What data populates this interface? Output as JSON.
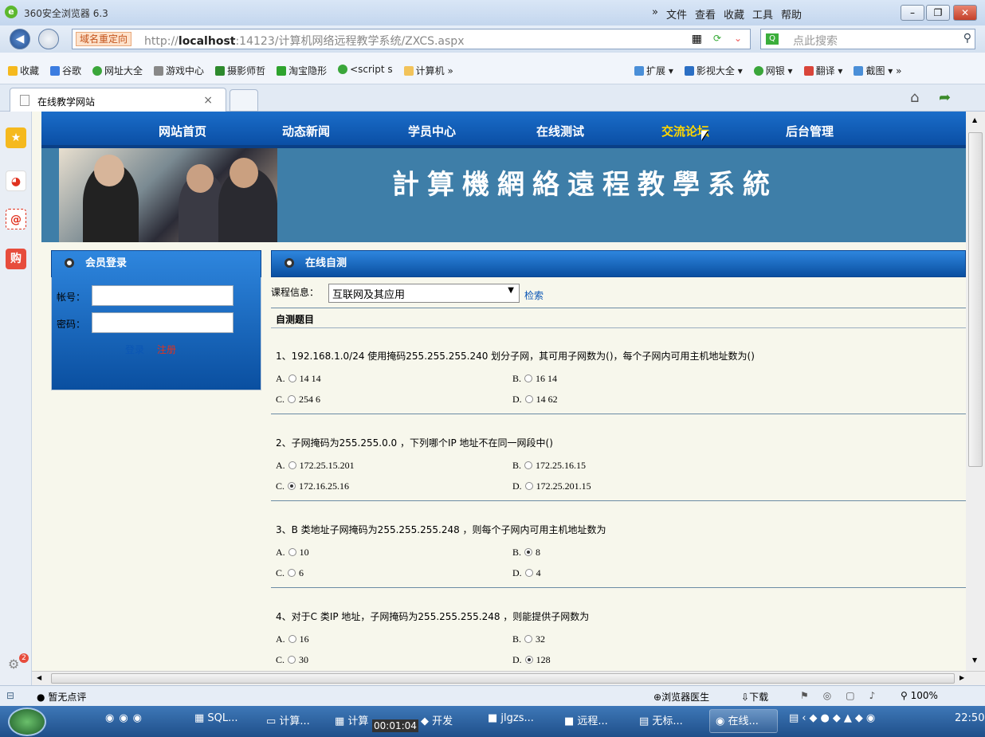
{
  "browser": {
    "title": "360安全浏览器 6.3",
    "menus": [
      "文件",
      "查看",
      "收藏",
      "工具",
      "帮助"
    ],
    "redirect_label": "域名重定向",
    "url_prefix": "http://",
    "url_host": "localhost",
    "url_rest": ":14123/计算机网络远程教学系统/ZXCS.aspx",
    "search_placeholder": "点此搜索",
    "search_engine": "Q",
    "favorites": [
      "收藏",
      "谷歌",
      "网址大全",
      "游戏中心",
      "摄影师哲",
      "淘宝隐形",
      "<script s",
      "计算机"
    ],
    "favorites_more": "»",
    "right_tools": [
      "扩展",
      "影视大全",
      "网银",
      "翻译",
      "截图"
    ],
    "tab_title": "在线教学网站",
    "tab_close": "×",
    "status_left": "暂无点评",
    "status_doctor": "浏览器医生",
    "status_download": "下载",
    "zoom": "100%",
    "chevron": "»"
  },
  "site": {
    "nav": [
      "网站首页",
      "动态新闻",
      "学员中心",
      "在线测试",
      "交流论坛",
      "后台管理"
    ],
    "nav_active": "交流论坛",
    "banner_title": "計算機網絡遠程教學系統",
    "login": {
      "heading": "会员登录",
      "account_label": "帐号：",
      "password_label": "密码：",
      "login_link": "登录",
      "register_link": "注册"
    },
    "quiz": {
      "heading": "在线自测",
      "course_label": "课程信息：",
      "course_value": "互联网及其应用",
      "search_link": "检索",
      "section_title": "自测题目",
      "questions": [
        {
          "text": "1、192.168.1.0/24 使用掩码255.255.255.240 划分子网，其可用子网数为()，每个子网内可用主机地址数为()",
          "options": [
            {
              "label": "A.",
              "text": "14 14"
            },
            {
              "label": "B.",
              "text": "16 14"
            },
            {
              "label": "C.",
              "text": "254 6"
            },
            {
              "label": "D.",
              "text": "14 62"
            }
          ],
          "selected": -1
        },
        {
          "text": "2、子网掩码为255.255.0.0 ，下列哪个IP 地址不在同一网段中()",
          "options": [
            {
              "label": "A.",
              "text": "172.25.15.201"
            },
            {
              "label": "B.",
              "text": "172.25.16.15"
            },
            {
              "label": "C.",
              "text": "172.16.25.16"
            },
            {
              "label": "D.",
              "text": "172.25.201.15"
            }
          ],
          "selected": 2
        },
        {
          "text": "3、B 类地址子网掩码为255.255.255.248 ，则每个子网内可用主机地址数为",
          "options": [
            {
              "label": "A.",
              "text": "10"
            },
            {
              "label": "B.",
              "text": "8"
            },
            {
              "label": "C.",
              "text": "6"
            },
            {
              "label": "D.",
              "text": "4"
            }
          ],
          "selected": 1
        },
        {
          "text": "4、对于C 类IP 地址，子网掩码为255.255.255.248 ，则能提供子网数为",
          "options": [
            {
              "label": "A.",
              "text": "16"
            },
            {
              "label": "B.",
              "text": "32"
            },
            {
              "label": "C.",
              "text": "30"
            },
            {
              "label": "D.",
              "text": "128"
            }
          ],
          "selected": 3
        }
      ]
    }
  },
  "taskbar": {
    "items": [
      "SQL...",
      "计算...",
      "计算",
      "开发",
      "jlgzs...",
      "远程...",
      "无标...",
      "在线..."
    ],
    "timer": "00:01:04",
    "clock": "22:50"
  },
  "sidebar_badge": "2"
}
